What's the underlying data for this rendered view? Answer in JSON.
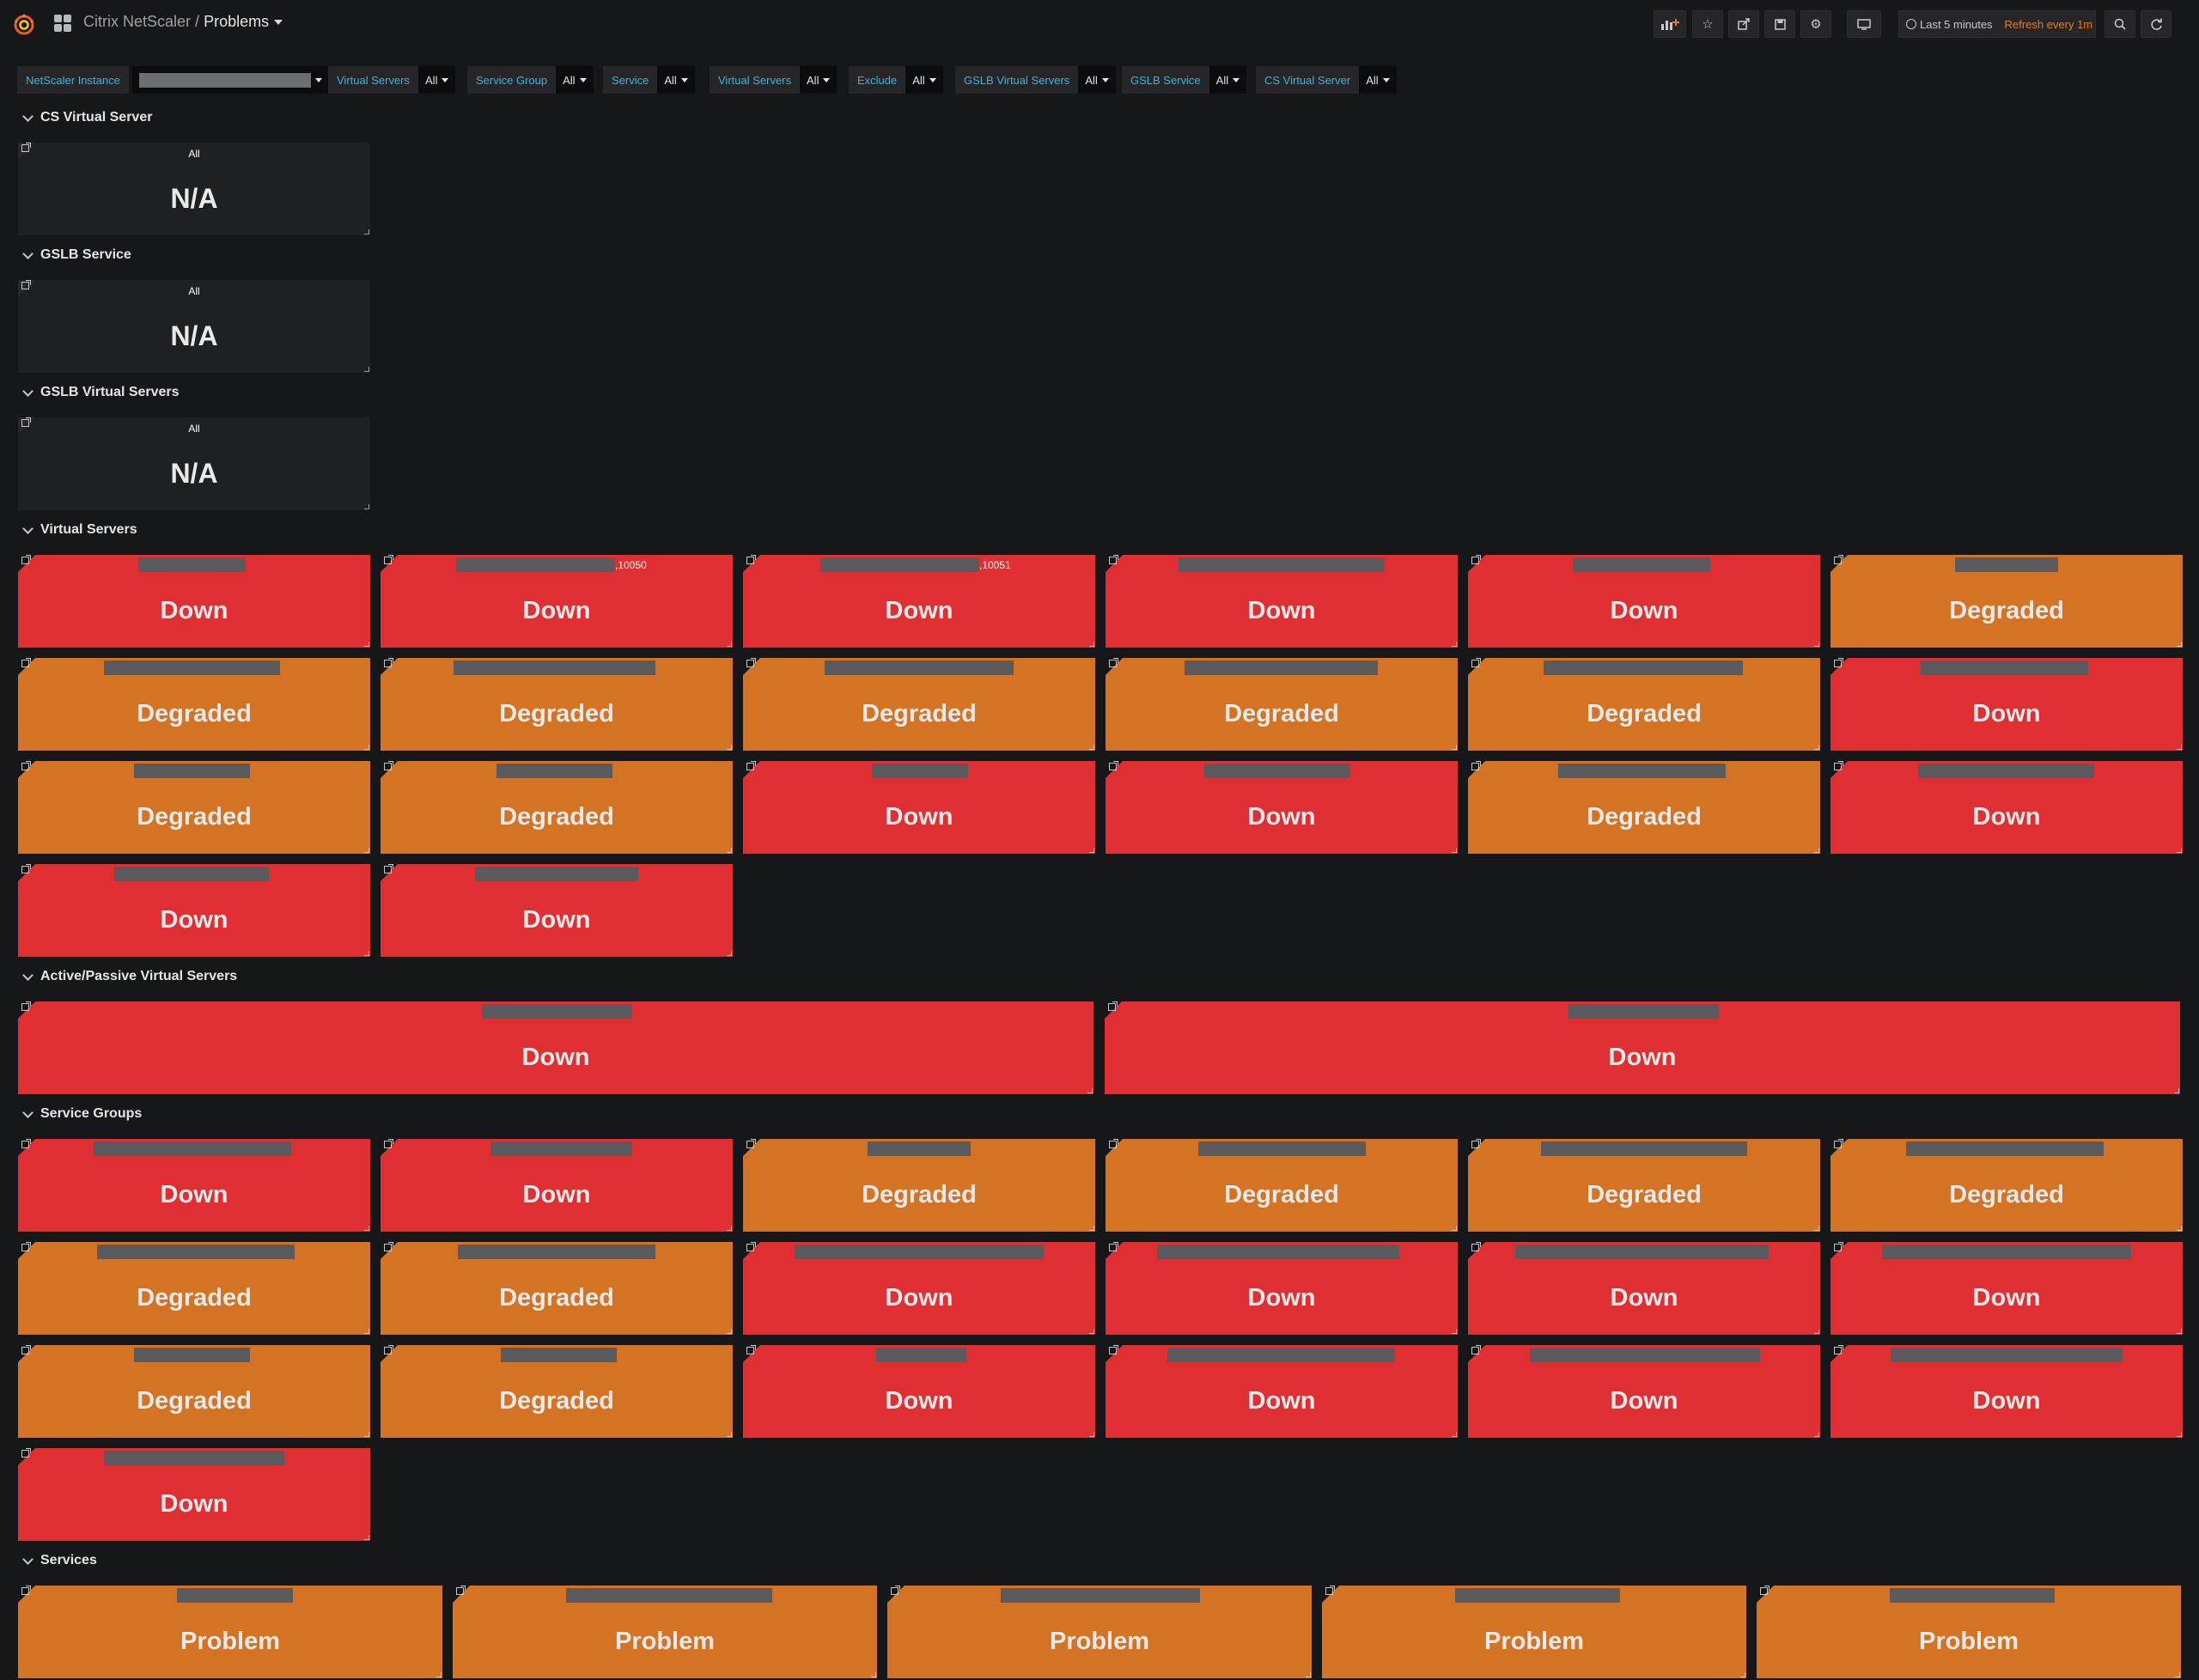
{
  "header": {
    "folder": "Citrix NetScaler",
    "separator": "/",
    "dashboard": "Problems"
  },
  "toolbar": {
    "icons": [
      "add-panel-icon",
      "star-icon",
      "share-icon",
      "save-icon",
      "gear-icon",
      "tv-mode-icon",
      "zoom-out-icon",
      "refresh-icon"
    ],
    "time_range": "Last 5 minutes",
    "refresh": "Refresh every 1m"
  },
  "variables": [
    {
      "label": "NetScaler Instance",
      "value": ""
    },
    {
      "label": "Virtual Servers",
      "value": "All"
    },
    {
      "label": "Service Group",
      "value": "All"
    },
    {
      "label": "Service",
      "value": "All"
    },
    {
      "label": "Virtual Servers",
      "value": "All"
    },
    {
      "label": "Exclude",
      "value": "All"
    },
    {
      "label": "GSLB Virtual Servers",
      "value": "All"
    },
    {
      "label": "GSLB Service",
      "value": "All"
    },
    {
      "label": "CS Virtual Server",
      "value": "All"
    }
  ],
  "rows": [
    {
      "title": "CS Virtual Server"
    },
    {
      "title": "GSLB Service"
    },
    {
      "title": "GSLB Virtual Servers"
    },
    {
      "title": "Virtual Servers"
    },
    {
      "title": "Active/Passive Virtual Servers"
    },
    {
      "title": "Service Groups"
    },
    {
      "title": "Services"
    }
  ],
  "panels": {
    "cs": [
      {
        "title": "All",
        "value": "N/A"
      }
    ],
    "gslb_service": [
      {
        "title": "All",
        "value": "N/A"
      }
    ],
    "gslb_vs": [
      {
        "title": "All",
        "value": "N/A"
      }
    ],
    "vs": [
      {
        "value": "Down",
        "state": "down"
      },
      {
        "value": "Down",
        "state": "down",
        "suffix": ",10050"
      },
      {
        "value": "Down",
        "state": "down",
        "suffix": ",10051"
      },
      {
        "value": "Down",
        "state": "down"
      },
      {
        "value": "Down",
        "state": "down"
      },
      {
        "value": "Degraded",
        "state": "deg"
      },
      {
        "value": "Degraded",
        "state": "deg"
      },
      {
        "value": "Degraded",
        "state": "deg"
      },
      {
        "value": "Degraded",
        "state": "deg"
      },
      {
        "value": "Degraded",
        "state": "deg"
      },
      {
        "value": "Degraded",
        "state": "deg"
      },
      {
        "value": "Down",
        "state": "down"
      },
      {
        "value": "Degraded",
        "state": "deg"
      },
      {
        "value": "Degraded",
        "state": "deg"
      },
      {
        "value": "Down",
        "state": "down"
      },
      {
        "value": "Down",
        "state": "down"
      },
      {
        "value": "Degraded",
        "state": "deg"
      },
      {
        "value": "Down",
        "state": "down"
      },
      {
        "value": "Down",
        "state": "down"
      },
      {
        "value": "Down",
        "state": "down"
      }
    ],
    "ap": [
      {
        "value": "Down",
        "state": "down"
      },
      {
        "value": "Down",
        "state": "down"
      }
    ],
    "sg": [
      {
        "value": "Down",
        "state": "down"
      },
      {
        "value": "Down",
        "state": "down"
      },
      {
        "value": "Degraded",
        "state": "deg"
      },
      {
        "value": "Degraded",
        "state": "deg"
      },
      {
        "value": "Degraded",
        "state": "deg"
      },
      {
        "value": "Degraded",
        "state": "deg"
      },
      {
        "value": "Degraded",
        "state": "deg"
      },
      {
        "value": "Degraded",
        "state": "deg"
      },
      {
        "value": "Down",
        "state": "down"
      },
      {
        "value": "Down",
        "state": "down"
      },
      {
        "value": "Down",
        "state": "down"
      },
      {
        "value": "Down",
        "state": "down"
      },
      {
        "value": "Degraded",
        "state": "deg"
      },
      {
        "value": "Degraded",
        "state": "deg"
      },
      {
        "value": "Down",
        "state": "down"
      },
      {
        "value": "Down",
        "state": "down"
      },
      {
        "value": "Down",
        "state": "down"
      },
      {
        "value": "Down",
        "state": "down"
      },
      {
        "value": "Down",
        "state": "down"
      }
    ],
    "svc": [
      {
        "value": "Problem",
        "state": "prob"
      },
      {
        "value": "Problem",
        "state": "prob"
      },
      {
        "value": "Problem",
        "state": "prob"
      },
      {
        "value": "Problem",
        "state": "prob"
      },
      {
        "value": "Problem",
        "state": "prob"
      }
    ]
  },
  "colors": {
    "down": "#e02f32",
    "degraded": "#d57324",
    "background": "#161719",
    "accent_label": "#33b5e5",
    "refresh_text": "#eb7b18"
  }
}
